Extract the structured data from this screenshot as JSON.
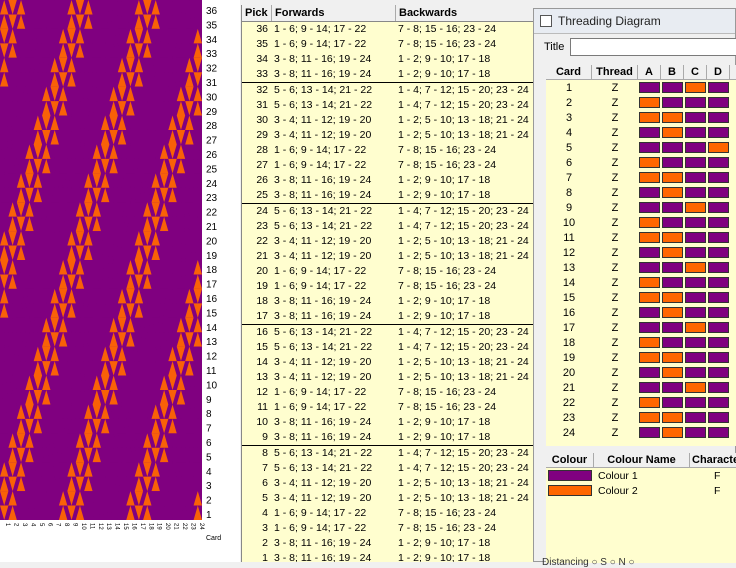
{
  "colors": {
    "purple": "#800080",
    "orange": "#ff6600",
    "table_bg": "#fffecf"
  },
  "weave": {
    "pick_labels": [
      "36",
      "35",
      "34",
      "33",
      "32",
      "31",
      "30",
      "29",
      "28",
      "27",
      "26",
      "25",
      "24",
      "23",
      "22",
      "21",
      "20",
      "19",
      "18",
      "17",
      "16",
      "15",
      "14",
      "13",
      "12",
      "11",
      "10",
      "9",
      "8",
      "7",
      "6",
      "5",
      "4",
      "3",
      "2",
      "1"
    ],
    "card_labels": [
      "1",
      "2",
      "3",
      "4",
      "5",
      "6",
      "7",
      "8",
      "9",
      "10",
      "11",
      "12",
      "13",
      "14",
      "15",
      "16",
      "17",
      "18",
      "19",
      "20",
      "21",
      "22",
      "23",
      "24"
    ],
    "card_axis_label": "Card"
  },
  "picks": {
    "headers": {
      "pick": "Pick",
      "forwards": "Forwards",
      "backwards": "Backwards"
    },
    "rows": [
      {
        "pick": "36",
        "fwd": "1 - 6; 9 - 14; 17 - 22",
        "bwd": "7 - 8; 15 - 16; 23 - 24"
      },
      {
        "pick": "35",
        "fwd": "1 - 6; 9 - 14; 17 - 22",
        "bwd": "7 - 8; 15 - 16; 23 - 24"
      },
      {
        "pick": "34",
        "fwd": "3 - 8; 11 - 16; 19 - 24",
        "bwd": "1 - 2; 9 - 10; 17 - 18"
      },
      {
        "pick": "33",
        "fwd": "3 - 8; 11 - 16; 19 - 24",
        "bwd": "1 - 2; 9 - 10; 17 - 18"
      },
      {
        "pick": "32",
        "fwd": "5 - 6; 13 - 14; 21 - 22",
        "bwd": "1 - 4; 7 - 12; 15 - 20; 23 - 24"
      },
      {
        "pick": "31",
        "fwd": "5 - 6; 13 - 14; 21 - 22",
        "bwd": "1 - 4; 7 - 12; 15 - 20; 23 - 24"
      },
      {
        "pick": "30",
        "fwd": "3 - 4; 11 - 12; 19 - 20",
        "bwd": "1 - 2; 5 - 10; 13 - 18; 21 - 24"
      },
      {
        "pick": "29",
        "fwd": "3 - 4; 11 - 12; 19 - 20",
        "bwd": "1 - 2; 5 - 10; 13 - 18; 21 - 24"
      },
      {
        "pick": "28",
        "fwd": "1 - 6; 9 - 14; 17 - 22",
        "bwd": "7 - 8; 15 - 16; 23 - 24"
      },
      {
        "pick": "27",
        "fwd": "1 - 6; 9 - 14; 17 - 22",
        "bwd": "7 - 8; 15 - 16; 23 - 24"
      },
      {
        "pick": "26",
        "fwd": "3 - 8; 11 - 16; 19 - 24",
        "bwd": "1 - 2; 9 - 10; 17 - 18"
      },
      {
        "pick": "25",
        "fwd": "3 - 8; 11 - 16; 19 - 24",
        "bwd": "1 - 2; 9 - 10; 17 - 18"
      },
      {
        "pick": "24",
        "fwd": "5 - 6; 13 - 14; 21 - 22",
        "bwd": "1 - 4; 7 - 12; 15 - 20; 23 - 24"
      },
      {
        "pick": "23",
        "fwd": "5 - 6; 13 - 14; 21 - 22",
        "bwd": "1 - 4; 7 - 12; 15 - 20; 23 - 24"
      },
      {
        "pick": "22",
        "fwd": "3 - 4; 11 - 12; 19 - 20",
        "bwd": "1 - 2; 5 - 10; 13 - 18; 21 - 24"
      },
      {
        "pick": "21",
        "fwd": "3 - 4; 11 - 12; 19 - 20",
        "bwd": "1 - 2; 5 - 10; 13 - 18; 21 - 24"
      },
      {
        "pick": "20",
        "fwd": "1 - 6; 9 - 14; 17 - 22",
        "bwd": "7 - 8; 15 - 16; 23 - 24"
      },
      {
        "pick": "19",
        "fwd": "1 - 6; 9 - 14; 17 - 22",
        "bwd": "7 - 8; 15 - 16; 23 - 24"
      },
      {
        "pick": "18",
        "fwd": "3 - 8; 11 - 16; 19 - 24",
        "bwd": "1 - 2; 9 - 10; 17 - 18"
      },
      {
        "pick": "17",
        "fwd": "3 - 8; 11 - 16; 19 - 24",
        "bwd": "1 - 2; 9 - 10; 17 - 18"
      },
      {
        "pick": "16",
        "fwd": "5 - 6; 13 - 14; 21 - 22",
        "bwd": "1 - 4; 7 - 12; 15 - 20; 23 - 24"
      },
      {
        "pick": "15",
        "fwd": "5 - 6; 13 - 14; 21 - 22",
        "bwd": "1 - 4; 7 - 12; 15 - 20; 23 - 24"
      },
      {
        "pick": "14",
        "fwd": "3 - 4; 11 - 12; 19 - 20",
        "bwd": "1 - 2; 5 - 10; 13 - 18; 21 - 24"
      },
      {
        "pick": "13",
        "fwd": "3 - 4; 11 - 12; 19 - 20",
        "bwd": "1 - 2; 5 - 10; 13 - 18; 21 - 24"
      },
      {
        "pick": "12",
        "fwd": "1 - 6; 9 - 14; 17 - 22",
        "bwd": "7 - 8; 15 - 16; 23 - 24"
      },
      {
        "pick": "11",
        "fwd": "1 - 6; 9 - 14; 17 - 22",
        "bwd": "7 - 8; 15 - 16; 23 - 24"
      },
      {
        "pick": "10",
        "fwd": "3 - 8; 11 - 16; 19 - 24",
        "bwd": "1 - 2; 9 - 10; 17 - 18"
      },
      {
        "pick": "9",
        "fwd": "3 - 8; 11 - 16; 19 - 24",
        "bwd": "1 - 2; 9 - 10; 17 - 18"
      },
      {
        "pick": "8",
        "fwd": "5 - 6; 13 - 14; 21 - 22",
        "bwd": "1 - 4; 7 - 12; 15 - 20; 23 - 24"
      },
      {
        "pick": "7",
        "fwd": "5 - 6; 13 - 14; 21 - 22",
        "bwd": "1 - 4; 7 - 12; 15 - 20; 23 - 24"
      },
      {
        "pick": "6",
        "fwd": "3 - 4; 11 - 12; 19 - 20",
        "bwd": "1 - 2; 5 - 10; 13 - 18; 21 - 24"
      },
      {
        "pick": "5",
        "fwd": "3 - 4; 11 - 12; 19 - 20",
        "bwd": "1 - 2; 5 - 10; 13 - 18; 21 - 24"
      },
      {
        "pick": "4",
        "fwd": "1 - 6; 9 - 14; 17 - 22",
        "bwd": "7 - 8; 15 - 16; 23 - 24"
      },
      {
        "pick": "3",
        "fwd": "1 - 6; 9 - 14; 17 - 22",
        "bwd": "7 - 8; 15 - 16; 23 - 24"
      },
      {
        "pick": "2",
        "fwd": "3 - 8; 11 - 16; 19 - 24",
        "bwd": "1 - 2; 9 - 10; 17 - 18"
      },
      {
        "pick": "1",
        "fwd": "3 - 8; 11 - 16; 19 - 24",
        "bwd": "1 - 2; 9 - 10; 17 - 18"
      }
    ]
  },
  "threading_window": {
    "title": "Threading Diagram",
    "title_label": "Title",
    "title_value": "",
    "card_headers": {
      "card": "Card",
      "thread": "Thread",
      "a": "A",
      "b": "B",
      "c": "C",
      "d": "D"
    },
    "cards": [
      {
        "card": "1",
        "thread": "Z",
        "holes": [
          "P",
          "P",
          "O",
          "P"
        ]
      },
      {
        "card": "2",
        "thread": "Z",
        "holes": [
          "O",
          "P",
          "P",
          "P"
        ]
      },
      {
        "card": "3",
        "thread": "Z",
        "holes": [
          "O",
          "O",
          "P",
          "P"
        ]
      },
      {
        "card": "4",
        "thread": "Z",
        "holes": [
          "P",
          "O",
          "P",
          "P"
        ]
      },
      {
        "card": "5",
        "thread": "Z",
        "holes": [
          "P",
          "P",
          "P",
          "O"
        ]
      },
      {
        "card": "6",
        "thread": "Z",
        "holes": [
          "O",
          "P",
          "P",
          "P"
        ]
      },
      {
        "card": "7",
        "thread": "Z",
        "holes": [
          "O",
          "O",
          "P",
          "P"
        ]
      },
      {
        "card": "8",
        "thread": "Z",
        "holes": [
          "P",
          "O",
          "P",
          "P"
        ]
      },
      {
        "card": "9",
        "thread": "Z",
        "holes": [
          "P",
          "P",
          "O",
          "P"
        ]
      },
      {
        "card": "10",
        "thread": "Z",
        "holes": [
          "O",
          "P",
          "P",
          "P"
        ]
      },
      {
        "card": "11",
        "thread": "Z",
        "holes": [
          "O",
          "O",
          "P",
          "P"
        ]
      },
      {
        "card": "12",
        "thread": "Z",
        "holes": [
          "P",
          "O",
          "P",
          "P"
        ]
      },
      {
        "card": "13",
        "thread": "Z",
        "holes": [
          "P",
          "P",
          "O",
          "P"
        ]
      },
      {
        "card": "14",
        "thread": "Z",
        "holes": [
          "O",
          "P",
          "P",
          "P"
        ]
      },
      {
        "card": "15",
        "thread": "Z",
        "holes": [
          "O",
          "O",
          "P",
          "P"
        ]
      },
      {
        "card": "16",
        "thread": "Z",
        "holes": [
          "P",
          "O",
          "P",
          "P"
        ]
      },
      {
        "card": "17",
        "thread": "Z",
        "holes": [
          "P",
          "P",
          "O",
          "P"
        ]
      },
      {
        "card": "18",
        "thread": "Z",
        "holes": [
          "O",
          "P",
          "P",
          "P"
        ]
      },
      {
        "card": "19",
        "thread": "Z",
        "holes": [
          "O",
          "O",
          "P",
          "P"
        ]
      },
      {
        "card": "20",
        "thread": "Z",
        "holes": [
          "P",
          "O",
          "P",
          "P"
        ]
      },
      {
        "card": "21",
        "thread": "Z",
        "holes": [
          "P",
          "P",
          "O",
          "P"
        ]
      },
      {
        "card": "22",
        "thread": "Z",
        "holes": [
          "O",
          "P",
          "P",
          "P"
        ]
      },
      {
        "card": "23",
        "thread": "Z",
        "holes": [
          "O",
          "O",
          "P",
          "P"
        ]
      },
      {
        "card": "24",
        "thread": "Z",
        "holes": [
          "P",
          "O",
          "P",
          "P"
        ]
      }
    ],
    "colour_headers": {
      "colour": "Colour",
      "name": "Colour Name",
      "character": "Characte"
    },
    "colours": [
      {
        "swatch": "#800080",
        "name": "Colour 1",
        "character": "F"
      },
      {
        "swatch": "#ff6600",
        "name": "Colour 2",
        "character": "F"
      }
    ],
    "bottom_text": "Distancing  ○ S    ○ N    ○"
  }
}
